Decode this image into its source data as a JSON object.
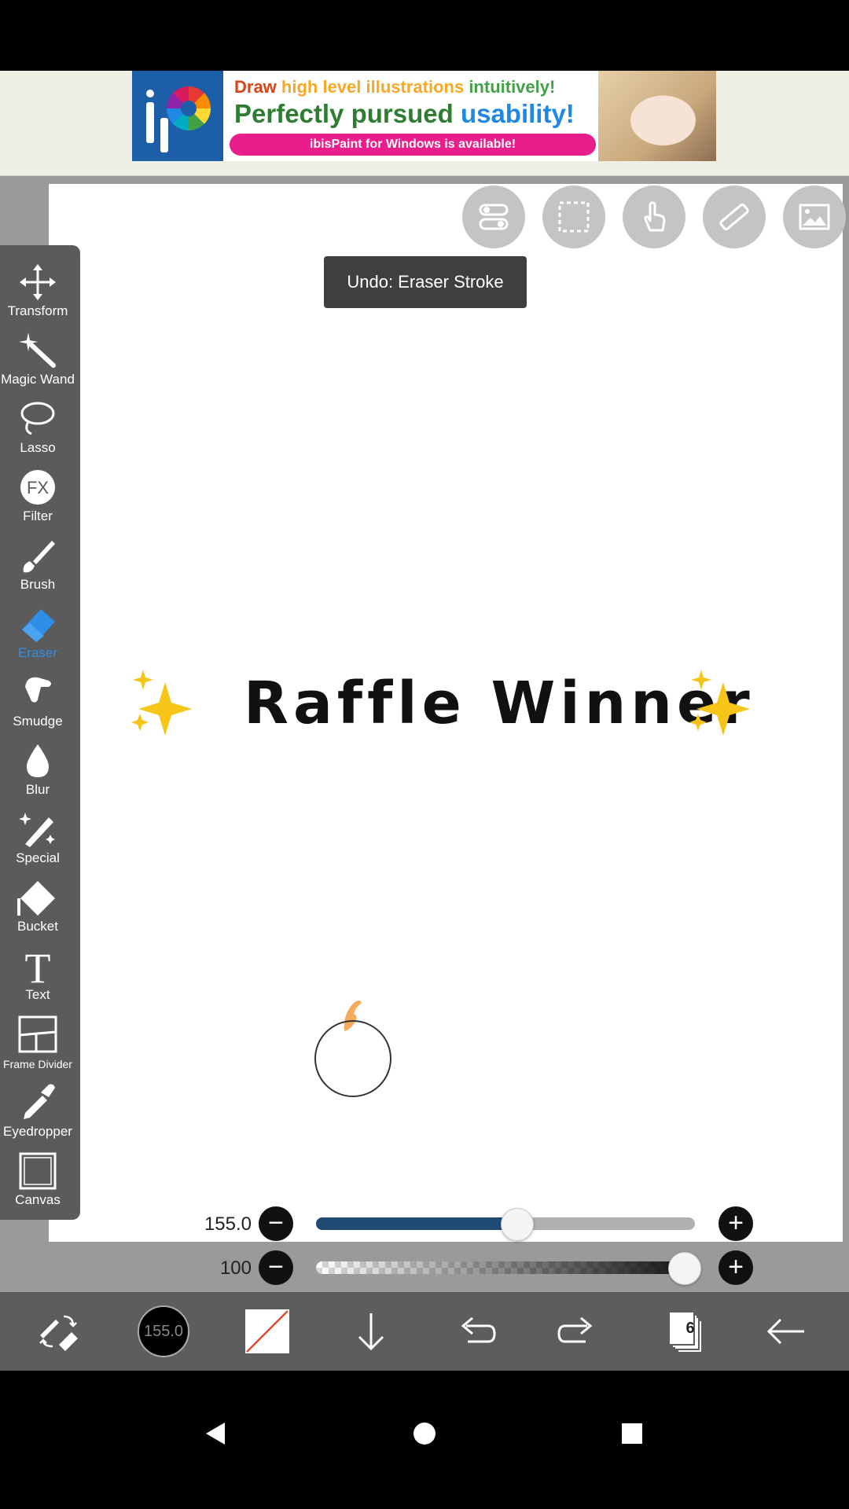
{
  "ad": {
    "line1_a": "Draw ",
    "line1_b": "high level illustrations ",
    "line1_c": "intuitively!",
    "line2_a": "Perfectly pursued ",
    "line2_b": "usability!",
    "pill": "ibisPaint for Windows is available!"
  },
  "toast": "Undo: Eraser Stroke",
  "toolbar": {
    "items": [
      {
        "label": "Transform",
        "icon": "move-arrows-icon"
      },
      {
        "label": "Magic Wand",
        "icon": "magic-wand-icon"
      },
      {
        "label": "Lasso",
        "icon": "lasso-icon"
      },
      {
        "label": "Filter",
        "icon": "fx-icon"
      },
      {
        "label": "Brush",
        "icon": "brush-icon"
      },
      {
        "label": "Eraser",
        "icon": "eraser-icon",
        "active": true
      },
      {
        "label": "Smudge",
        "icon": "smudge-icon"
      },
      {
        "label": "Blur",
        "icon": "drop-icon"
      },
      {
        "label": "Special",
        "icon": "special-pen-icon"
      },
      {
        "label": "Bucket",
        "icon": "bucket-icon"
      },
      {
        "label": "Text",
        "icon": "text-icon"
      },
      {
        "label": "Frame Divider",
        "icon": "frame-divider-icon"
      },
      {
        "label": "Eyedropper",
        "icon": "eyedropper-icon"
      },
      {
        "label": "Canvas",
        "icon": "canvas-icon"
      }
    ]
  },
  "canvas": {
    "headline": "Raffle Winner"
  },
  "sliders": {
    "size_value": "155.0",
    "size_fraction": 0.53,
    "opacity_value": "100",
    "opacity_fraction": 1.0
  },
  "bottom": {
    "brush_size": "155.0",
    "layer_count": "6"
  },
  "colors": {
    "active_tool": "#2f8fe8",
    "slider_fill": "#1e4a73",
    "toolbar_bg": "#5b5b5b"
  }
}
